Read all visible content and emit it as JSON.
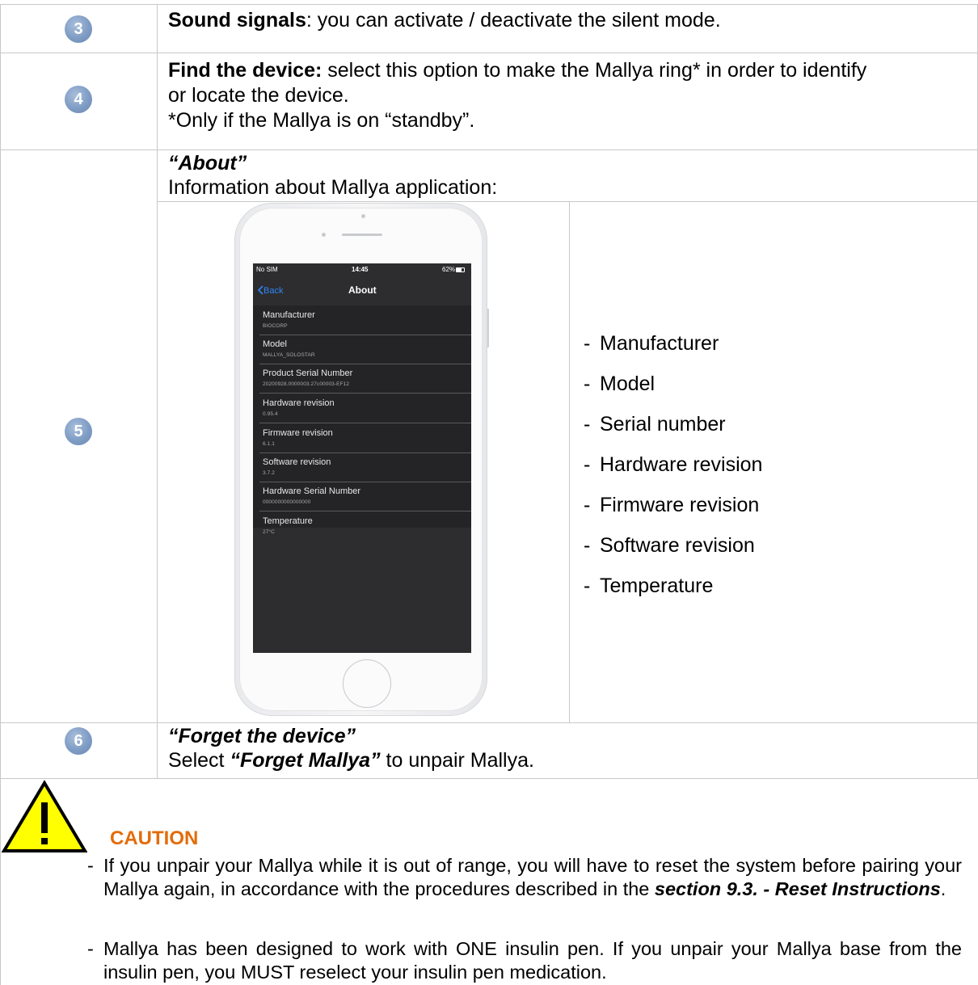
{
  "rows": {
    "row3": {
      "badge": "3",
      "title": "Sound signals",
      "text": ": you can activate / deactivate the silent mode."
    },
    "row4": {
      "badge": "4",
      "title": "Find the device:",
      "text": " select this option to make the Mallya ring* in order to identify",
      "text2": "or locate the device.",
      "note": "*Only if the Mallya is on “standby”."
    },
    "row5": {
      "badge": "5",
      "heading": "“About”",
      "subheading": "Information about Mallya application:"
    },
    "row6": {
      "badge": "6",
      "heading": "“Forget the device”",
      "text_pre": "Select ",
      "text_bold": "“Forget Mallya”",
      "text_post": " to unpair Mallya."
    }
  },
  "phone": {
    "status": {
      "carrier": "No SIM",
      "time": "14:45",
      "battery": "62%"
    },
    "nav": {
      "back": "Back",
      "title": "About"
    },
    "items": [
      {
        "label": "Manufacturer",
        "value": "BIOCORP"
      },
      {
        "label": "Model",
        "value": "MALLYA_SOLOSTAR"
      },
      {
        "label": "Product Serial Number",
        "value": "20200928.0000003.27c00003-EF12"
      },
      {
        "label": "Hardware revision",
        "value": "0.95.4"
      },
      {
        "label": "Firmware revision",
        "value": "6.1.1"
      },
      {
        "label": "Software revision",
        "value": "3.7.2"
      },
      {
        "label": "Hardware Serial Number",
        "value": "0000000000000000"
      },
      {
        "label": "Temperature",
        "value": "27°C"
      }
    ]
  },
  "about_list": [
    "Manufacturer",
    "Model",
    "Serial number",
    "Hardware revision",
    "Firmware revision",
    "Software revision",
    "Temperature"
  ],
  "bullet": "-",
  "caution": {
    "title": "CAUTION",
    "item1_text": "If you unpair your Mallya while it is out of range, you will have to reset the system before pairing your Mallya again, in accordance with the procedures described in the ",
    "item1_bold": "section 9.3. - Reset Instructions",
    "item1_end": ".",
    "item2_text": "Mallya has been designed to work with ONE insulin pen. If you unpair your Mallya base from the insulin pen, you MUST reselect your insulin pen medication."
  },
  "colors": {
    "badge": "#7f9cc4",
    "caution": "#e36c0a",
    "warning_fill": "#ffff00",
    "screen": "#2d2d2f"
  }
}
